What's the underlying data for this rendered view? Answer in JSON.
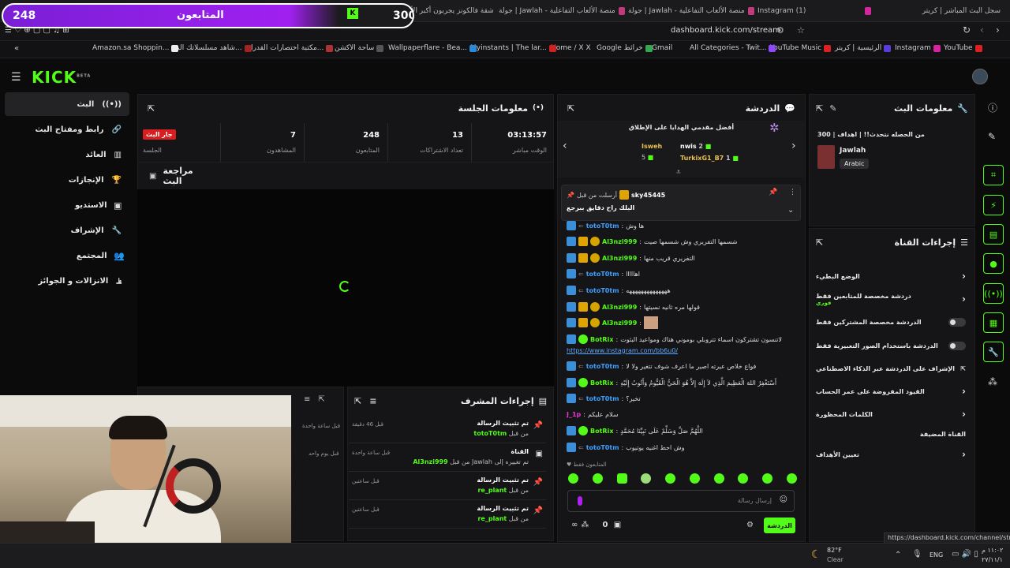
{
  "browser": {
    "tabs": [
      {
        "label": "سجل البث المباشر | كريتر"
      },
      {
        "label": "Instagram (1)"
      },
      {
        "label": "جولة | Jawlah - منصة الألعاب التفاعلية"
      },
      {
        "label": "جولة | Jawlah - منصة الألعاب التفاعلية"
      },
      {
        "label": "شقة فالكونز يجربون أكبر الألعاب بمستوى"
      }
    ],
    "address": "dashboard.kick.com/stream",
    "bookmarks": [
      "YouTube",
      "Instagram",
      "الرئيسية | كريتر",
      "YouTube Music",
      "All Categories - Twit...",
      "Gmail",
      "Google خرائط",
      "Home / X",
      "Myinstants | The lar...",
      "Wallpaperflare - Bea...",
      "ساحة الاكشن",
      "مكتبة اختصارات القدرا...",
      "شاهد مسلسلاتك الم...",
      "Amazon.sa Shoppin..."
    ]
  },
  "overlay": {
    "left_number": "248",
    "title": "المتابعون",
    "right_number": "300"
  },
  "kick": {
    "logo": "KICK",
    "beta": "BETA"
  },
  "nav": {
    "items": [
      {
        "label": "البث"
      },
      {
        "label": "رابط ومفتاح البث"
      },
      {
        "label": "العائد"
      },
      {
        "label": "الإنجازات"
      },
      {
        "label": "الاستديو"
      },
      {
        "label": "الإشراف"
      },
      {
        "label": "المجتمع"
      },
      {
        "label": "الانزالات و الجوائز"
      }
    ]
  },
  "session": {
    "title": "معلومات الجلسة",
    "live_badge": "جار البث",
    "live_label": "الجلسة",
    "stats": [
      {
        "value": "03:13:57",
        "label": "الوقت مباشر"
      },
      {
        "value": "13",
        "label": "تعداد الاشتراكات"
      },
      {
        "value": "248",
        "label": "المتابعون"
      },
      {
        "value": "7",
        "label": "المشاهدون"
      }
    ]
  },
  "review": {
    "title": "مراجعة البث"
  },
  "chat": {
    "title": "الدردشة",
    "gifters_title": "أفضل مقدمي الهدايا على الإطلاق",
    "gifters": [
      {
        "name": "nwis",
        "count": "2"
      },
      {
        "name": "Isweh",
        "count": "5"
      },
      {
        "name": "TurkixG1_B7",
        "count": "1"
      }
    ],
    "pinned_by": "sky45445",
    "pinned_prefix": "أرسلت من قبل",
    "pinned_text": "البلك راح دقايق ببرجع",
    "messages": [
      {
        "user": "totoT0tm",
        "text": "ها وش"
      },
      {
        "user": "Al3nzi999",
        "text": "شسمها التفريري وش شسمها صيت"
      },
      {
        "user": "Al3nzi999",
        "text": "التفريري قريب منها"
      },
      {
        "user": "totoT0tm",
        "text": "اهااااا"
      },
      {
        "user": "totoT0tm",
        "text": "ههههههههههههههه"
      },
      {
        "user": "Al3nzi999",
        "text": "قولها مره ثانيه نسيتها"
      },
      {
        "user": "Al3nzi999",
        "text": ""
      },
      {
        "user": "BotRix",
        "text": "لاتنسون تشتركون اسماء تتروبلي بوموني هناك ومواعيد البثوت"
      },
      {
        "user": "",
        "text": "https://www.instagram.com/bb6u0/"
      },
      {
        "user": "totoT0tm",
        "text": "فواع خلاص عيرته اصير ما اعرف شوف تتغير ولا لا"
      },
      {
        "user": "BotRix",
        "text": "أَسْتَغْفِرُ اللهَ الْعَظِيمَ الَّذِي لاَ إِلَهَ إِلاَّ هُوَ الْحَيُّ الْقَيُّومُ وَأَتُوبُ إِلَيْهِ"
      },
      {
        "user": "totoT0tm",
        "text": "تخير؟"
      },
      {
        "user": "J_1p",
        "text": "سلام عليكم"
      },
      {
        "user": "BotRix",
        "text": "اللَّهُمَّ صَلِّ وَسَلِّمْ عَلَى نَبِيِّنَا مُحَمَّدٍ"
      },
      {
        "user": "totoT0tm",
        "text": "وش احط اغنيه يوتيوب"
      }
    ],
    "followers_only": "المتابعون فقط",
    "input_placeholder": "إرسال رسالة",
    "send_label": "الدردشة",
    "points": "0"
  },
  "modactions": {
    "title": "إجراءات المشرف",
    "rows": [
      {
        "title": "تم تثبيت الرسالة",
        "sub_prefix": "من قبل",
        "user": "totoT0tm",
        "time": "قبل 46 دقيقة"
      },
      {
        "title": "القناة",
        "sub_prefix": "من قبل Jawlah تم تغييره إلى",
        "user": "Al3nzi999",
        "time": "قبل ساعة واحدة"
      },
      {
        "title": "تم تثبيت الرسالة",
        "sub_prefix": "من قبل",
        "user": "re_plant",
        "time": "قبل ساعتين"
      },
      {
        "title": "تم تثبيت الرسالة",
        "sub_prefix": "من قبل",
        "user": "re_plant",
        "time": "قبل ساعتين"
      }
    ],
    "left_times": [
      "قبل ساعة واحدة",
      "قبل يوم واحد"
    ]
  },
  "streaminfo": {
    "title": "معلومات البث",
    "stream_title": "من الحصله نتحدث!! | اهداف | 300",
    "category": "Jawlah",
    "language": "Arabic"
  },
  "channel_actions": {
    "title": "إجراءات القناة",
    "rows": [
      {
        "label": "الوضع البطيء",
        "control": "chevron"
      },
      {
        "label": "دردشة مخصصة للمتابعين فقط",
        "sub": "فوري",
        "control": "chevron"
      },
      {
        "label": "الدردشة مخصصة المشتركين فقط",
        "control": "toggle"
      },
      {
        "label": "الدردشة باستخدام الصور التعبيرية فقط",
        "control": "toggle"
      },
      {
        "label": "الإشراف على الدردشة عبر الذكاء الاصطناعي",
        "control": "external"
      },
      {
        "label": "القيود المفروضة على عمر الحساب",
        "control": "chevron"
      },
      {
        "label": "الكلمات المحظورة",
        "control": "chevron"
      },
      {
        "label": "القناة المضيفة",
        "control": ""
      },
      {
        "label": "تعيين الأهداف",
        "control": "chevron"
      }
    ]
  },
  "statusbar": {
    "url": "https://dashboard.kick.com/channel/stream"
  },
  "taskbar": {
    "weather_temp": "82°F",
    "weather_desc": "Clear",
    "lang": "ENG",
    "time": "١١:٠٢ م",
    "date": "٢٧/١١/١"
  },
  "colors": {
    "accent": "#53fc18",
    "panel": "#151517",
    "pill": "#9b20e8"
  }
}
